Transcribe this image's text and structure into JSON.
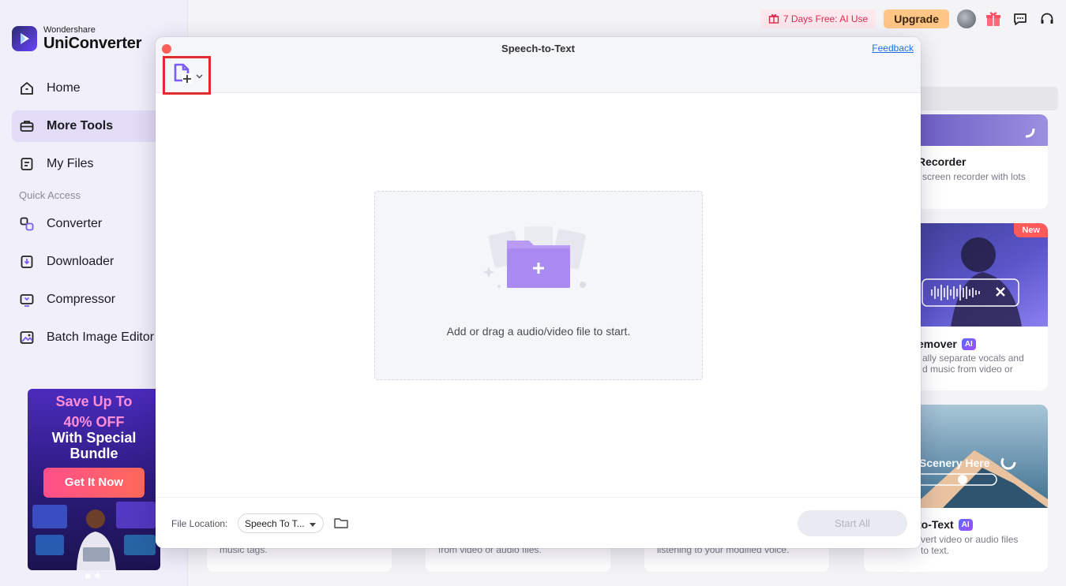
{
  "app": {
    "brand_sub": "Wondershare",
    "brand_main": "UniConverter"
  },
  "sidebar": {
    "items": [
      {
        "label": "Home",
        "icon": "home-icon"
      },
      {
        "label": "More Tools",
        "icon": "toolbox-icon"
      },
      {
        "label": "My Files",
        "icon": "files-icon"
      }
    ],
    "section_label": "Quick Access",
    "quick_items": [
      {
        "label": "Converter",
        "icon": "converter-icon"
      },
      {
        "label": "Downloader",
        "icon": "downloader-icon"
      },
      {
        "label": "Compressor",
        "icon": "compressor-icon"
      },
      {
        "label": "Batch Image Editor",
        "icon": "image-editor-icon"
      }
    ],
    "promo": {
      "line1": "Save Up To",
      "line2": "40% OFF",
      "line3": "With Special",
      "line4": "Bundle",
      "cta": "Get It Now"
    }
  },
  "topbar": {
    "trial_label": "7 Days Free: AI Use",
    "upgrade_label": "Upgrade"
  },
  "background_cards": {
    "card1_title": "Recorder",
    "card1_desc": "screen recorder with lots",
    "card2_badge": "New",
    "card2_title": "emover",
    "card2_desc": "ally separate vocals and\nd music from video or",
    "card3_overlay": "Scenery Here",
    "card3_title": "to-Text",
    "card3_desc": "vert video or audio files\nto text.",
    "ai_badge": "AI",
    "bottom1_desc": "music tags.",
    "bottom2_desc": "from video or audio files.",
    "bottom3_desc": "listening to your modified voice."
  },
  "modal": {
    "title": "Speech-to-Text",
    "feedback": "Feedback",
    "dropzone_text": "Add or drag a audio/video file to start.",
    "file_location_label": "File Location:",
    "file_location_value": "Speech To T...",
    "start_all": "Start All"
  },
  "colors": {
    "accent_purple": "#7b5cf6",
    "highlight_red": "#e02c2c",
    "close_red": "#ff5f57",
    "link_blue": "#1e6fe8"
  }
}
